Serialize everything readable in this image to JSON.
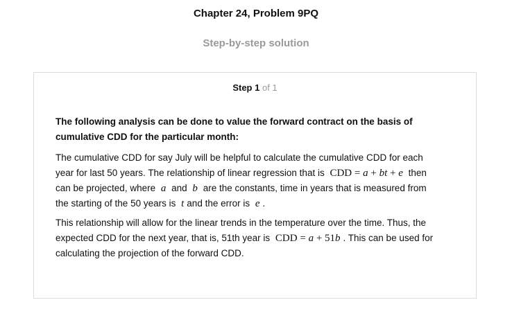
{
  "header": {
    "chapter_title": "Chapter 24, Problem 9PQ",
    "subtitle": "Step-by-step solution"
  },
  "step": {
    "label": "Step 1",
    "total": "of 1"
  },
  "content": {
    "intro_line1": "The following analysis can be done to value the forward contract on the basis of",
    "intro_line2": "cumulative CDD for the particular month:",
    "p1_l1": "The cumulative CDD for say July will be helpful to calculate the cumulative CDD for each",
    "p1_l2_pre": "year for last 50 years. The relationship of linear regression that is",
    "p1_l2_math_cdd": "CDD",
    "p1_l2_math_eq": "= ",
    "p1_l2_math_a": "a",
    "p1_l2_math_plus1": " + ",
    "p1_l2_math_bt": "bt",
    "p1_l2_math_plus2": " + ",
    "p1_l2_math_e": "e",
    "p1_l2_post": "then",
    "p1_l3_pre": "can be projected, where",
    "p1_l3_var_a": "a",
    "p1_l3_and": "and",
    "p1_l3_var_b": "b",
    "p1_l3_post": "are the constants, time in years that is measured from",
    "p1_l4_pre": "the starting of the 50 years is",
    "p1_l4_var_t": "t",
    "p1_l4_mid": "and the error is",
    "p1_l4_var_e": "e",
    "p1_l4_end": ".",
    "p2_l1": "This relationship will allow for the linear trends in the temperature over the time. Thus, the",
    "p2_l2_pre": "expected CDD for the next year, that is, 51th year is",
    "p2_l2_math_cdd": "CDD",
    "p2_l2_math_eq": "= ",
    "p2_l2_math_a": "a",
    "p2_l2_math_plus": " + 51",
    "p2_l2_math_b": "b",
    "p2_l2_post": ". This can be used for",
    "p2_l3": "calculating the projection of the forward CDD."
  }
}
